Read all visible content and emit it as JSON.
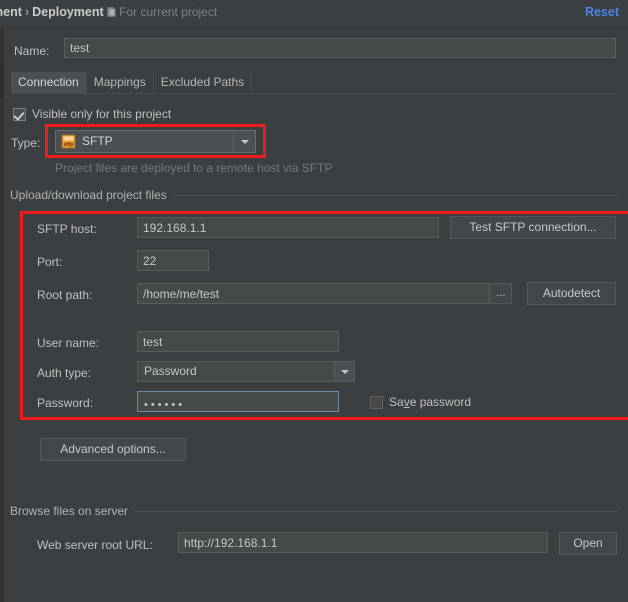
{
  "header": {
    "breadcrumb_root": "loyment",
    "breadcrumb_sep": "›",
    "breadcrumb_current": "Deployment",
    "scope_note": "For current project",
    "scope_icon": "project-icon",
    "reset_label": "Reset",
    "reset_color": "#4b86e8"
  },
  "name_row": {
    "label": "Name:",
    "value": "test"
  },
  "tabs": [
    {
      "label": "Connection",
      "active": true
    },
    {
      "label": "Mappings",
      "active": false
    },
    {
      "label": "Excluded Paths",
      "active": false
    }
  ],
  "visible_only": {
    "label": "Visible only for this project",
    "checked": true
  },
  "type_row": {
    "label": "Type:",
    "value": "SFTP",
    "icon": "sftp-icon",
    "hint": "Project files are deployed to a remote host via SFTP"
  },
  "upload_group": {
    "title": "Upload/download project files",
    "fields": {
      "sftp_host": {
        "label": "SFTP host:",
        "value": "192.168.1.1"
      },
      "port": {
        "label": "Port:",
        "value": "22"
      },
      "root_path": {
        "label": "Root path:",
        "value": "/home/me/test"
      },
      "user_name": {
        "label": "User name:",
        "value": "test"
      },
      "auth_type": {
        "label": "Auth type:",
        "value": "Password"
      },
      "password": {
        "label": "Password:",
        "value": "••••••",
        "focused": true
      }
    },
    "buttons": {
      "test_connection": "Test SFTP connection...",
      "browse_ellipsis": "...",
      "autodetect": "Autodetect",
      "advanced_options": "Advanced options..."
    },
    "save_password": {
      "label_pre": "Sa",
      "label_mn": "v",
      "label_post": "e password",
      "checked": false
    }
  },
  "browse_group": {
    "title": "Browse files on server",
    "web_url": {
      "label": "Web server root URL:",
      "value": "http://192.168.1.1"
    },
    "open_button": "Open"
  },
  "annotations": {
    "highlight_color": "#ee1c1c",
    "boxes": [
      {
        "name": "type-combo-highlight"
      },
      {
        "name": "connection-fields-highlight"
      }
    ]
  }
}
